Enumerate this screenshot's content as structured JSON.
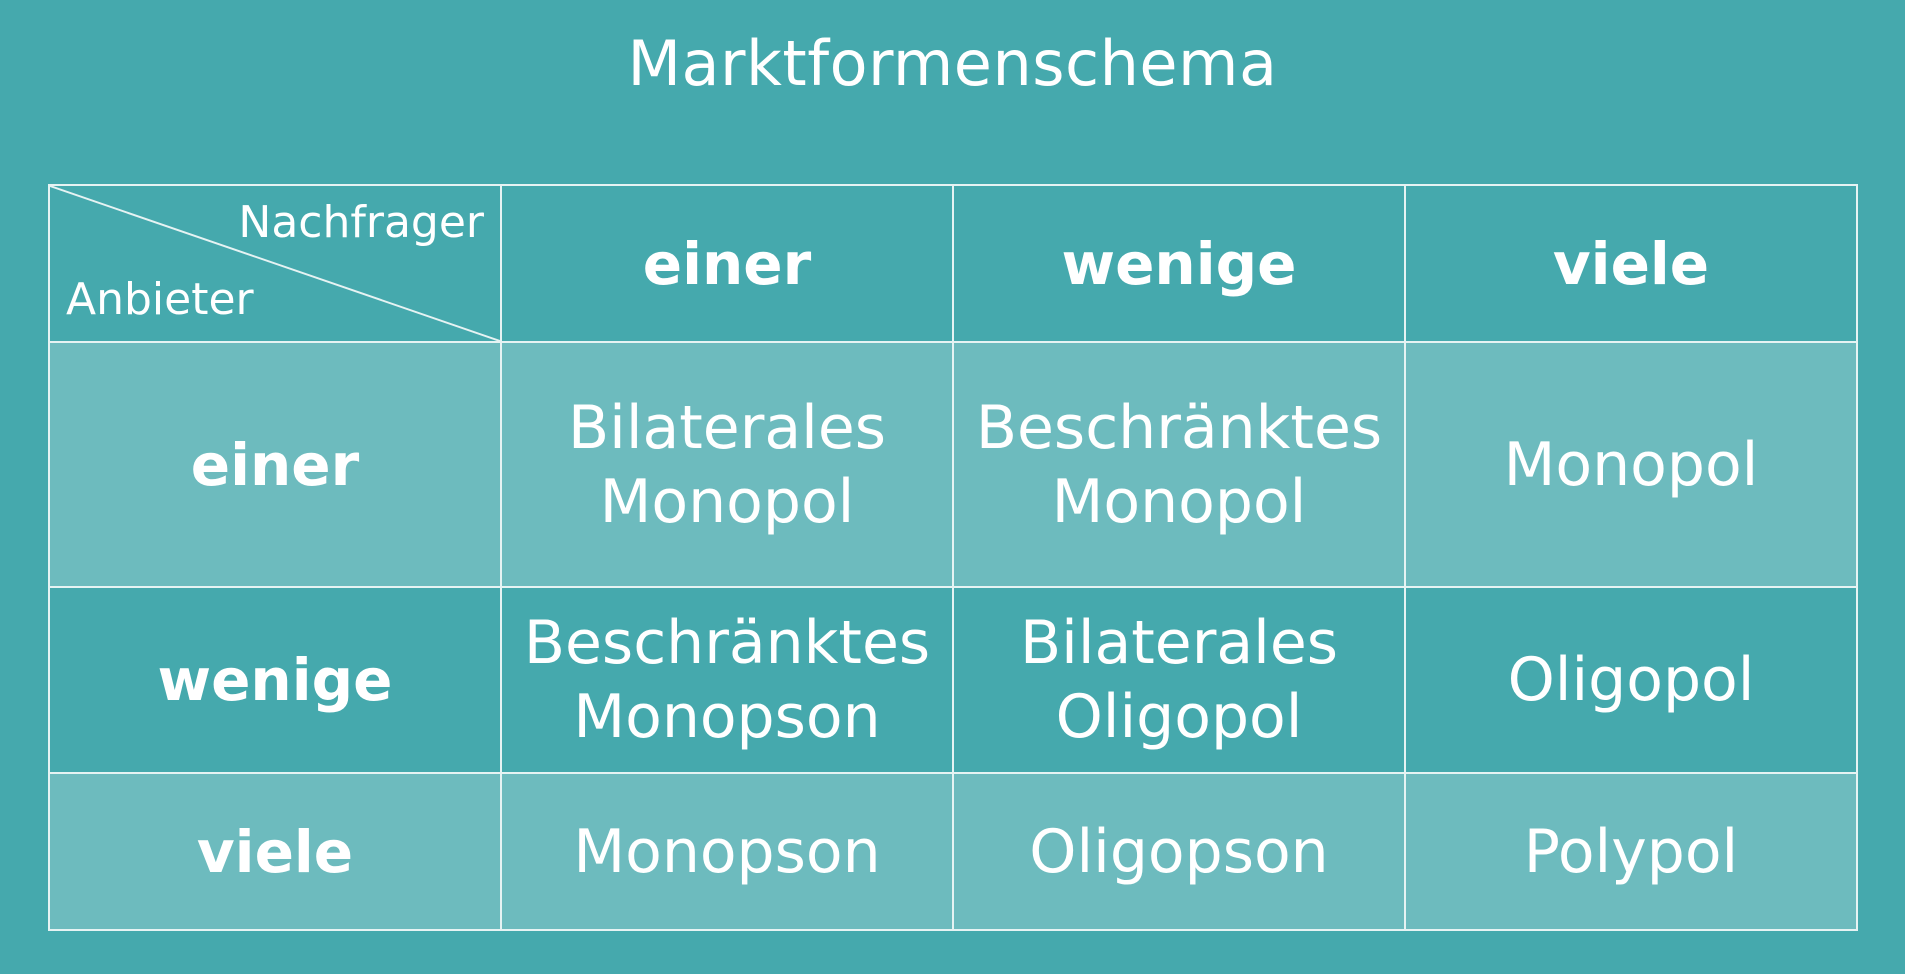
{
  "title": "Marktformenschema",
  "corner": {
    "top_label": "Nachfrager",
    "bottom_label": "Anbieter"
  },
  "columns": [
    "einer",
    "wenige",
    "viele"
  ],
  "rows": [
    {
      "label": "einer",
      "cells": [
        [
          "Bilaterales",
          "Monopol"
        ],
        [
          "Beschränktes",
          "Monopol"
        ],
        [
          "Monopol"
        ]
      ]
    },
    {
      "label": "wenige",
      "cells": [
        [
          "Beschränktes",
          "Monopson"
        ],
        [
          "Bilaterales",
          "Oligopol"
        ],
        [
          "Oligopol"
        ]
      ]
    },
    {
      "label": "viele",
      "cells": [
        [
          "Monopson"
        ],
        [
          "Oligopson"
        ],
        [
          "Polypol"
        ]
      ]
    }
  ],
  "colors": {
    "background": "#45a9ad",
    "light_row": "#6dbbbe",
    "grid_line": "#e6f3f3",
    "text": "#ffffff"
  }
}
